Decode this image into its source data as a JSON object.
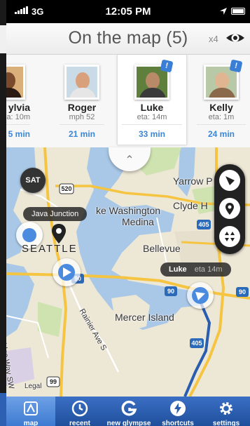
{
  "status_bar": {
    "carrier": "3G",
    "time": "12:05 PM"
  },
  "header": {
    "title": "On the map (5)",
    "multiplier": "x4"
  },
  "contacts": [
    {
      "name": "ylvia",
      "sub": "a: 10m",
      "mins": "5 min",
      "badge": ""
    },
    {
      "name": "Roger",
      "sub": "mph 52",
      "mins": "21 min",
      "badge": ""
    },
    {
      "name": "Luke",
      "sub": "eta: 14m",
      "mins": "33 min",
      "badge": "!"
    },
    {
      "name": "Kelly",
      "sub": "eta: 1m",
      "mins": "24 min",
      "badge": "!"
    }
  ],
  "map": {
    "sat_label": "SAT",
    "pin_label": "Java Junction",
    "city_label": "SEATTLE",
    "luke_tag": {
      "name": "Luke",
      "eta": "eta 14m"
    },
    "places": [
      "Yarrow P",
      "Clyde H",
      "ke Washington",
      "Medina",
      "Bellevue",
      "Mercer Island",
      "Rainier Ave S",
      "Delridge Way SW",
      "Legal"
    ],
    "shields": [
      "520",
      "405",
      "90",
      "90",
      "90",
      "405",
      "99"
    ]
  },
  "tabs": [
    {
      "label": "map",
      "icon": "map-icon"
    },
    {
      "label": "recent",
      "icon": "clock-icon"
    },
    {
      "label": "new glympse",
      "icon": "glympse-icon"
    },
    {
      "label": "shortcuts",
      "icon": "lightning-icon"
    },
    {
      "label": "settings",
      "icon": "gear-icon"
    }
  ],
  "colors": {
    "accent": "#3a86d8",
    "tabbar": "#2a5db0",
    "water": "#a9c7e6",
    "land": "#ede7d6"
  }
}
